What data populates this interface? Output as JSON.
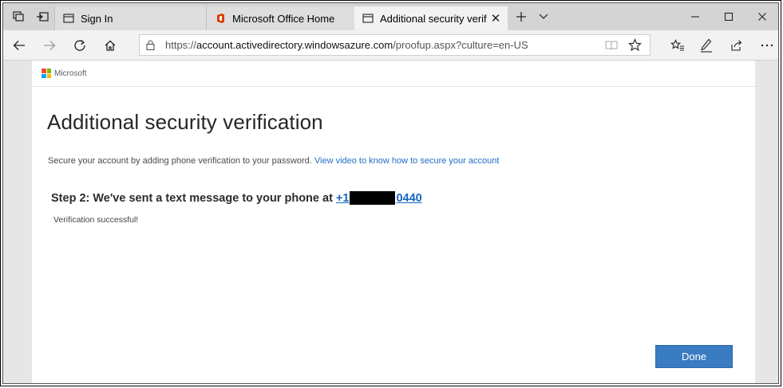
{
  "browser": {
    "tabs": [
      {
        "label": "Sign In",
        "icon": "page-icon",
        "active": false
      },
      {
        "label": "Microsoft Office Home",
        "icon": "office-logo-icon",
        "active": false
      },
      {
        "label": "Additional security verif",
        "icon": "page-icon",
        "active": true
      }
    ],
    "address": {
      "scheme": "https://",
      "host": "account.activedirectory.windowsazure.com",
      "path": "/proofup.aspx?culture=en-US"
    }
  },
  "brand": {
    "name": "Microsoft"
  },
  "page": {
    "title": "Additional security verification",
    "intro_text": "Secure your account by adding phone verification to your password.",
    "intro_link": "View video to know how to secure your account",
    "step_text": "Step 2: We've sent a text message to your phone at",
    "phone_prefix": "+1",
    "phone_suffix": "0440",
    "status_text": "Verification successful!",
    "done_label": "Done"
  },
  "colors": {
    "accent_blue": "#3a7cc1",
    "link_blue": "#1f6fc5",
    "office_red": "#d83b01"
  }
}
